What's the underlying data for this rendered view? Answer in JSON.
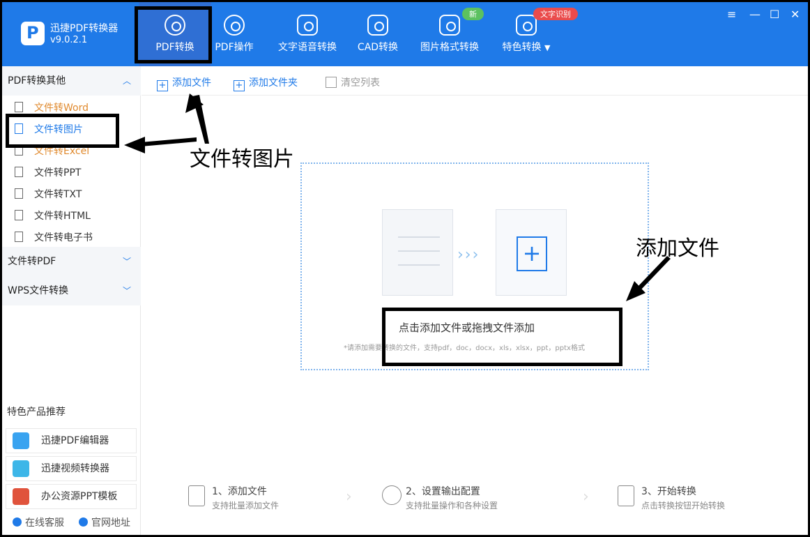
{
  "app": {
    "title": "迅捷PDF转换器",
    "version": "v9.0.2.1",
    "accent": "#1f7ae8"
  },
  "nav": [
    {
      "label": "PDF转换",
      "icon": "pdf-convert-icon",
      "active": true
    },
    {
      "label": "PDF操作",
      "icon": "pdf-operate-icon"
    },
    {
      "label": "文字语音转换",
      "icon": "voice-icon"
    },
    {
      "label": "CAD转换",
      "icon": "cad-icon"
    },
    {
      "label": "图片格式转换",
      "icon": "image-icon",
      "badge": "新"
    },
    {
      "label": "特色转换",
      "icon": "star-icon",
      "badge": "文字识别",
      "dropdown": "▼"
    }
  ],
  "window_controls": [
    "≡",
    "—",
    "☐",
    "✕"
  ],
  "sidebar": {
    "section1": "PDF转换其他",
    "items": [
      "文件转Word",
      "文件转图片",
      "文件转Excel",
      "文件转PPT",
      "文件转TXT",
      "文件转HTML",
      "文件转电子书"
    ],
    "section2": "文件转PDF",
    "section3": "WPS文件转换",
    "rec_title": "特色产品推荐",
    "rec_items": [
      "迅捷PDF编辑器",
      "迅捷视频转换器",
      "办公资源PPT模板"
    ],
    "footer": [
      "在线客服",
      "官网地址"
    ]
  },
  "toolbar": {
    "add_file": "添加文件",
    "add_folder": "添加文件夹",
    "clear": "清空列表"
  },
  "drop": {
    "main": "点击添加文件或拖拽文件添加",
    "hint": "*请添加需要转换的文件，支持pdf，doc，docx，xls，xlsx，ppt，pptx格式",
    "arrows": "›››"
  },
  "annotations": {
    "left": "文件转图片",
    "right": "添加文件"
  },
  "steps": [
    {
      "title": "1、添加文件",
      "desc": "支持批量添加文件"
    },
    {
      "title": "2、设置输出配置",
      "desc": "支持批量操作和各种设置"
    },
    {
      "title": "3、开始转换",
      "desc": "点击转换按钮开始转换"
    }
  ]
}
